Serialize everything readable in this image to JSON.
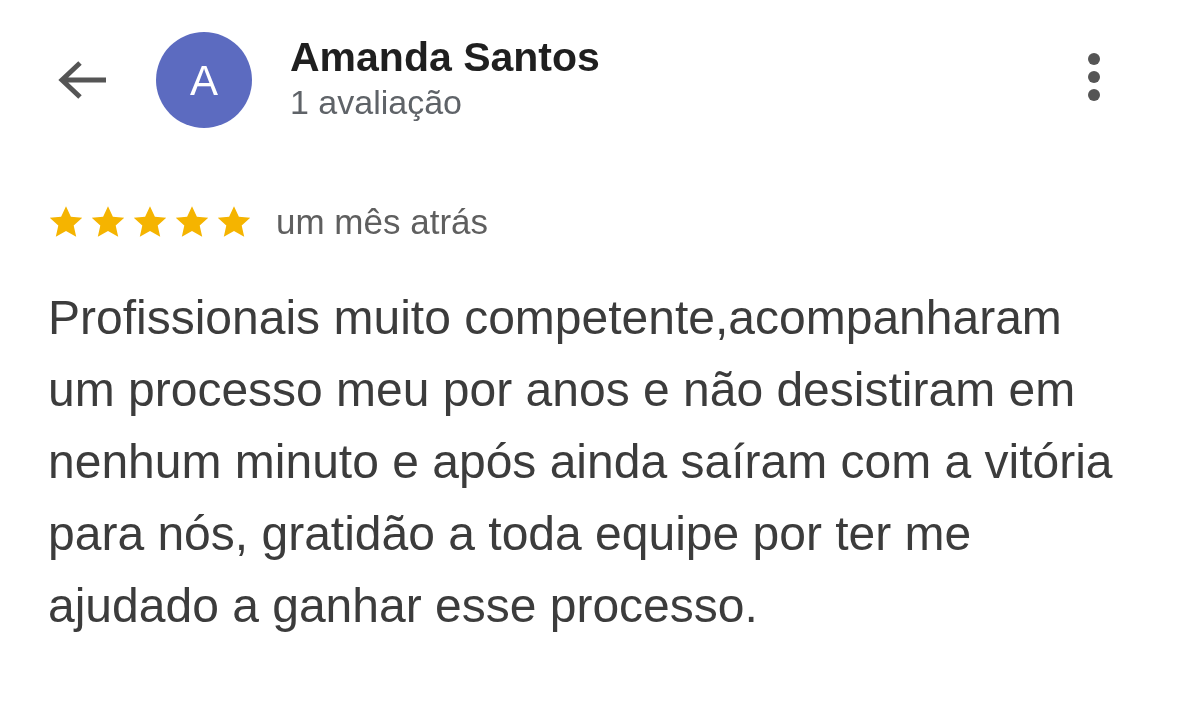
{
  "header": {
    "avatar_letter": "A",
    "name": "Amanda Santos",
    "subtitle": "1 avaliação"
  },
  "review": {
    "stars": 5,
    "time": "um mês atrás",
    "text": "Profissionais muito competente,acompanharam um processo meu por anos e não desistiram em nenhum minuto e após ainda saíram com a vitória para nós, gratidão a toda equipe por ter me ajudado a ganhar esse processo."
  }
}
